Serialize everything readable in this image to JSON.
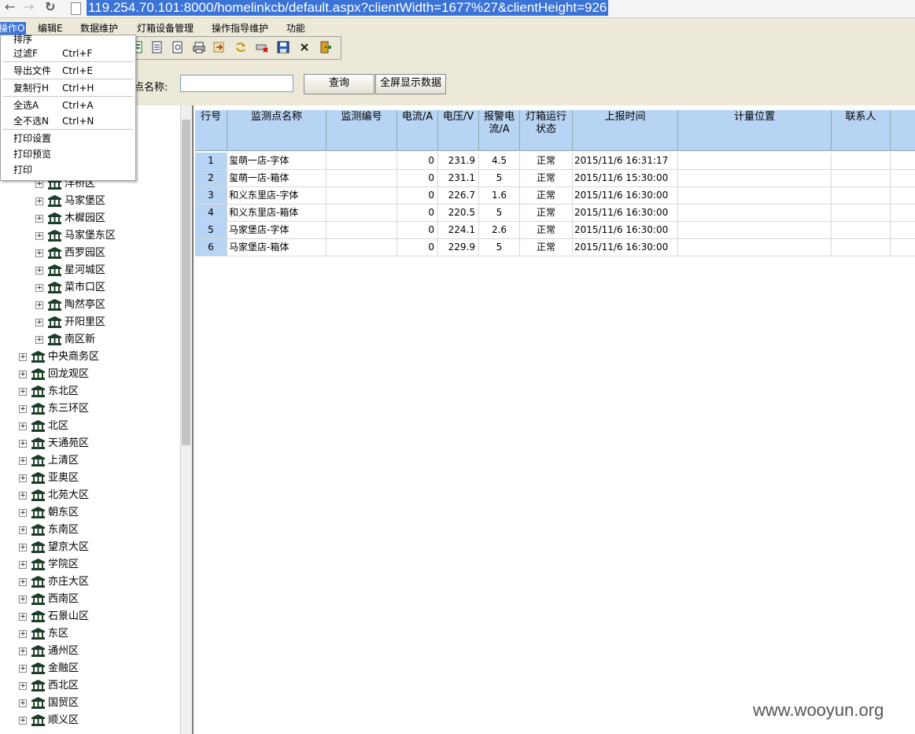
{
  "browser": {
    "url": "119.254.70.101:8000/homelinkcb/default.aspx?clientWidth=1677%27&clientHeight=926"
  },
  "menu": {
    "items": [
      "操作O",
      "编辑E",
      "数据维护",
      "灯箱设备管理",
      "操作指导维护",
      "功能"
    ]
  },
  "dropdown": {
    "items": [
      {
        "label": "排序",
        "shortcut": ""
      },
      {
        "label": "过滤F",
        "shortcut": "Ctrl+F"
      },
      {
        "label": "导出文件",
        "shortcut": "Ctrl+E"
      },
      {
        "label": "复制行H",
        "shortcut": "Ctrl+H"
      },
      {
        "label": "全选A",
        "shortcut": "Ctrl+A"
      },
      {
        "label": "全不选N",
        "shortcut": "Ctrl+N"
      },
      {
        "label": "打印设置",
        "shortcut": ""
      },
      {
        "label": "打印预览",
        "shortcut": ""
      },
      {
        "label": "打印",
        "shortcut": ""
      }
    ]
  },
  "query": {
    "label": "点名称:",
    "input_value": "",
    "search_button": "查询",
    "fullscreen_button": "全屏显示数据"
  },
  "tree": {
    "sub_nodes": [
      "洋桥区",
      "马家堡区",
      "木樨园区",
      "马家堡东区",
      "西罗园区",
      "星河城区",
      "菜市口区",
      "陶然亭区",
      "开阳里区",
      "南区新"
    ],
    "top_nodes": [
      "中央商务区",
      "回龙观区",
      "东北区",
      "东三环区",
      "北区",
      "天通苑区",
      "上清区",
      "亚奥区",
      "北苑大区",
      "朝东区",
      "东南区",
      "望京大区",
      "学院区",
      "亦庄大区",
      "西南区",
      "石景山区",
      "东区",
      "通州区",
      "金融区",
      "西北区",
      "国贸区",
      "顺义区"
    ]
  },
  "grid": {
    "columns": [
      "行号",
      "监测点名称",
      "监测编号",
      "电流/A",
      "电压/V",
      "报警电流/A",
      "灯箱运行状态",
      "上报时间",
      "计量位置",
      "联系人"
    ],
    "rows": [
      [
        "1",
        "玺萌一店-字体",
        "",
        "0",
        "231.9",
        "4.5",
        "正常",
        "2015/11/6 16:31:17",
        "",
        ""
      ],
      [
        "2",
        "玺萌一店-箱体",
        "",
        "0",
        "231.1",
        "5",
        "正常",
        "2015/11/6 15:30:00",
        "",
        ""
      ],
      [
        "3",
        "和义东里店-字体",
        "",
        "0",
        "226.7",
        "1.6",
        "正常",
        "2015/11/6 16:30:00",
        "",
        ""
      ],
      [
        "4",
        "和义东里店-箱体",
        "",
        "0",
        "220.5",
        "5",
        "正常",
        "2015/11/6 16:30:00",
        "",
        ""
      ],
      [
        "5",
        "马家堡店-字体",
        "",
        "0",
        "224.1",
        "2.6",
        "正常",
        "2015/11/6 16:30:00",
        "",
        ""
      ],
      [
        "6",
        "马家堡店-箱体",
        "",
        "0",
        "229.9",
        "5",
        "正常",
        "2015/11/6 16:30:00",
        "",
        ""
      ]
    ]
  },
  "watermark": "www.wooyun.org",
  "colors": {
    "selection": "#3b73d6",
    "header": "#b8d4f4",
    "chrome": "#ece9d8"
  }
}
